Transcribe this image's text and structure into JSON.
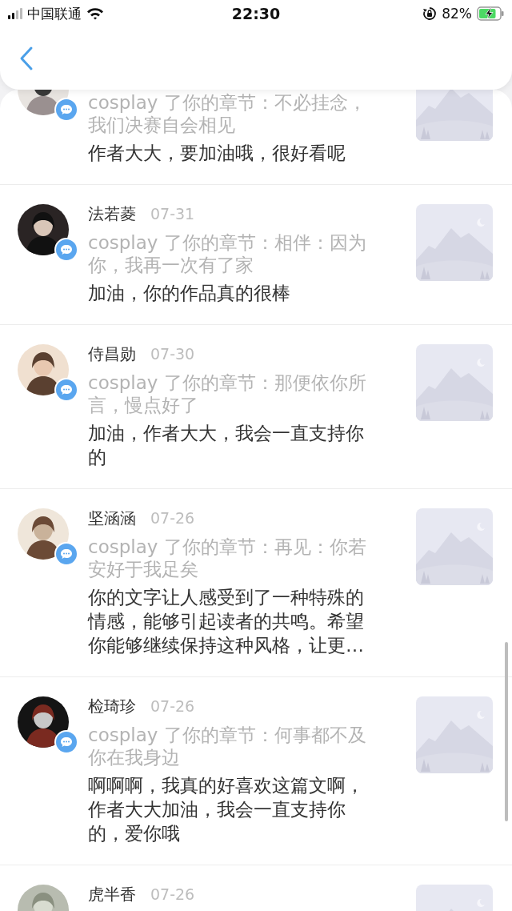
{
  "status_bar": {
    "carrier": "中国联通",
    "time": "22:30",
    "battery": "82%"
  },
  "notifications": [
    {
      "chapter_text": "cosplay 了你的章节：不必挂念，我们决赛自会相见",
      "comment": "作者大大，要加油哦，很好看呢"
    },
    {
      "name": "法若菱",
      "date": "07-31",
      "chapter_text": "cosplay 了你的章节：相伴：因为你，我再一次有了家",
      "comment": "加油，你的作品真的很棒"
    },
    {
      "name": "侍昌勋",
      "date": "07-30",
      "chapter_text": "cosplay 了你的章节：那便依你所言，慢点好了",
      "comment": "加油，作者大大，我会一直支持你的"
    },
    {
      "name": "坚涵涵",
      "date": "07-26",
      "chapter_text": "cosplay 了你的章节：再见：你若安好于我足矣",
      "comment": "你的文字让人感受到了一种特殊的情感，能够引起读者的共鸣。希望你能够继续保持这种风格，让更…"
    },
    {
      "name": "检琦珍",
      "date": "07-26",
      "chapter_text": "cosplay 了你的章节：何事都不及你在我身边",
      "comment": "啊啊啊，我真的好喜欢这篇文啊，作者大大加油，我会一直支持你的，爱你哦"
    },
    {
      "name": "虎半香",
      "date": "07-26"
    }
  ]
}
